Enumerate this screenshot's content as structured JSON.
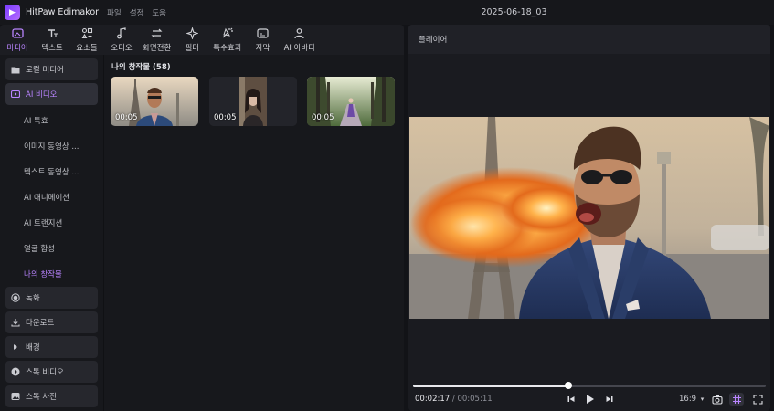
{
  "app": {
    "name": "HitPaw Edimakor",
    "menu": [
      "파일",
      "설정",
      "도움"
    ],
    "project_title": "2025-06-18_03"
  },
  "toolbar": {
    "tabs": [
      {
        "label": "미디어",
        "icon": "media-icon",
        "active": true
      },
      {
        "label": "텍스트",
        "icon": "text-icon",
        "active": false
      },
      {
        "label": "요소들",
        "icon": "elements-icon",
        "active": false
      },
      {
        "label": "오디오",
        "icon": "audio-icon",
        "active": false
      },
      {
        "label": "화면전환",
        "icon": "transition-icon",
        "active": false
      },
      {
        "label": "필터",
        "icon": "filter-icon",
        "active": false
      },
      {
        "label": "특수효과",
        "icon": "effects-icon",
        "active": false
      },
      {
        "label": "자막",
        "icon": "subtitle-icon",
        "active": false
      },
      {
        "label": "AI 아바타",
        "icon": "avatar-icon",
        "active": false
      }
    ]
  },
  "sidebar": {
    "local_media": "로컬 미디어",
    "ai_video": "AI 비디오",
    "ai_subitems": [
      "AI 특효",
      "이미지 동영상 ...",
      "텍스트 동영상 ...",
      "AI 애니메이션",
      "AI 트랜지션",
      "얼굴 합성",
      "나의 창작물"
    ],
    "ai_active_sub": "나의 창작물",
    "record": "녹화",
    "download": "다운로드",
    "background": "배경",
    "stock_video": "스톡 비디오",
    "stock_photo": "스톡 사진"
  },
  "media_panel": {
    "title": "나의 창작물 (58)",
    "thumbnails": [
      {
        "duration": "00:05",
        "subject": "man-eiffel"
      },
      {
        "duration": "00:05",
        "subject": "woman-portrait"
      },
      {
        "duration": "00:05",
        "subject": "girl-forest"
      }
    ]
  },
  "player": {
    "title": "플레이어",
    "current_time": "00:02:17",
    "separator": " / ",
    "total_time": "00:05:11",
    "progress": 0.44,
    "aspect_ratio": "16:9",
    "colors": {
      "accent": "#b984ff",
      "fire": "#ff9b2e"
    }
  }
}
